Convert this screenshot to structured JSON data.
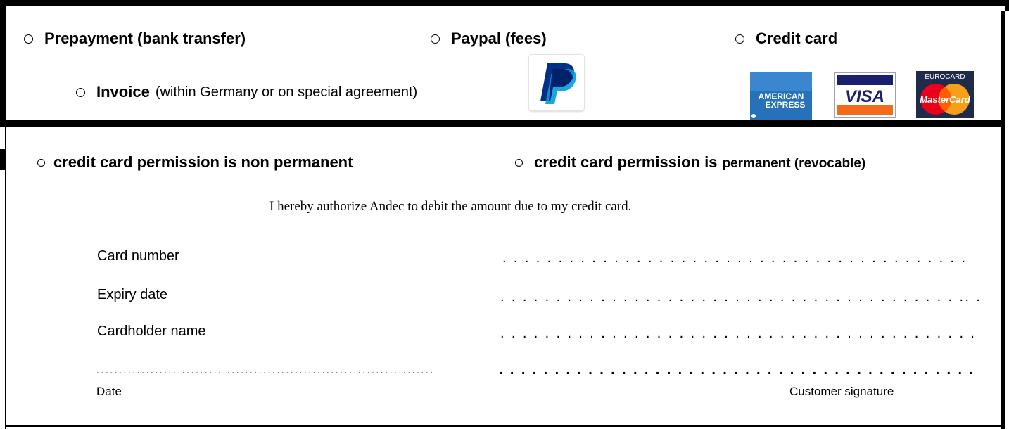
{
  "payment_options": {
    "prepayment": "Prepayment (bank transfer)",
    "paypal": "Paypal (fees)",
    "credit_card": "Credit card",
    "invoice_label": "Invoice",
    "invoice_note": "(within Germany or on special agreement)"
  },
  "logos": {
    "amex_line1": "AMERICAN",
    "amex_line2": "EXPRESS",
    "visa": "VISA",
    "eurocard": "EUROCARD",
    "mastercard": "MasterCard"
  },
  "permission": {
    "non_permanent": "credit card permission is non permanent",
    "permanent_prefix": "credit card permission is",
    "permanent_suffix": "permanent (revocable)"
  },
  "statement": "I hereby authorize Andec to debit the amount due to my credit card.",
  "fields": {
    "card_number": {
      "label": "Card number",
      "dots": ". . . . . . . . . . . . . . . . . . . . . . . . . . . . . . . . . . . . . . . . . ."
    },
    "expiry_date": {
      "label": "Expiry date",
      "dots": ". . . . . . . . . . . . . . . . . . . . . . . . . . . . . . . . . . . . . . . . . .. ."
    },
    "cardholder_name": {
      "label": "Cardholder name",
      "dots": ". . . . . . . . . . . . . . . . . . . . . . . . . . . . . . . . . . . . . . .  . . . ."
    }
  },
  "signature": {
    "date_dots": "...........................................................................",
    "sig_dots": ". . . . . . . . . . . . . . . . . . . . . . . . . . . . . . . . . . . . . . .  . . . .",
    "date_label": "Date",
    "customer_signature_label": "Customer signature"
  },
  "colors": {
    "paypal_dark": "#003087",
    "paypal_light": "#009cde",
    "amex_blue": "#2671b9",
    "visa_blue": "#1a1f71",
    "visa_orange": "#f7a600",
    "mc_red": "#eb001b",
    "mc_orange": "#f79e1b"
  }
}
